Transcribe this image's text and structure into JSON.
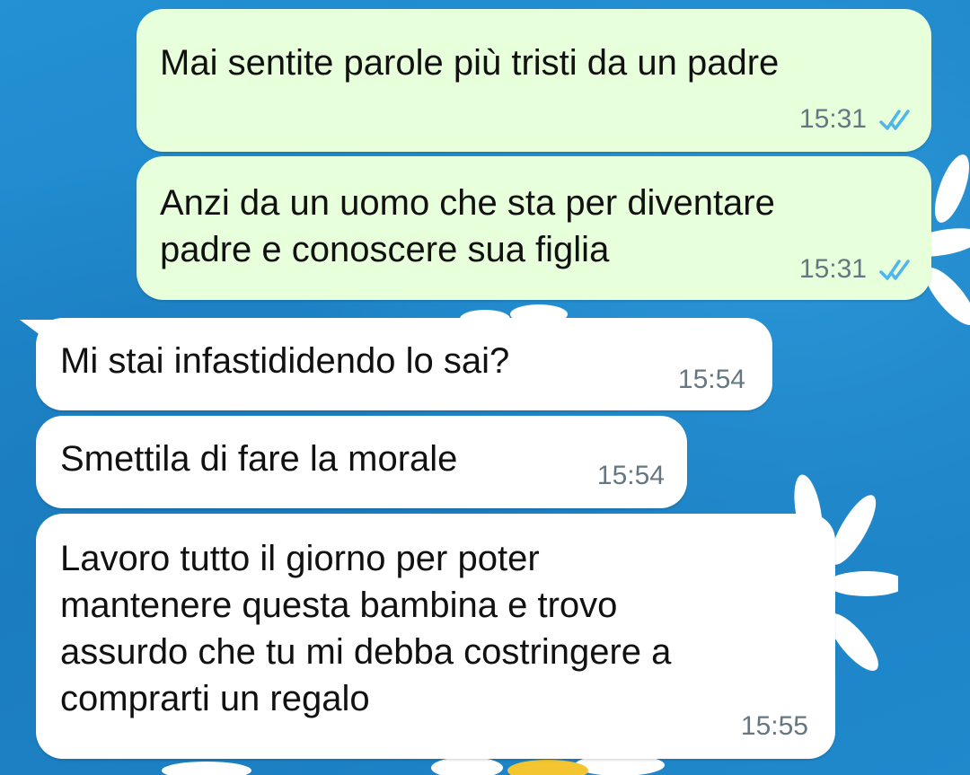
{
  "chat": {
    "messages": [
      {
        "direction": "outgoing",
        "text": "Mai sentite parole più tristi da un padre",
        "time": "15:31",
        "status": "read",
        "status_icon": "double-check-icon"
      },
      {
        "direction": "outgoing",
        "text": "Anzi da un uomo che sta per diventare\npadre e conoscere sua figlia",
        "time": "15:31",
        "status": "read",
        "status_icon": "double-check-icon"
      },
      {
        "direction": "incoming",
        "text": "Mi stai infastididendo lo sai?",
        "time": "15:54"
      },
      {
        "direction": "incoming",
        "text": "Smettila di fare la morale",
        "time": "15:54"
      },
      {
        "direction": "incoming",
        "text": "Lavoro tutto il giorno per poter\nmantenere questa bambina e trovo\nassurdo che tu mi debba costringere a\ncomprarti un regalo",
        "time": "15:55"
      }
    ]
  },
  "theme": {
    "outgoing_bubble": "#e7ffdb",
    "incoming_bubble": "#ffffff",
    "read_tick_color": "#4fb6ec",
    "timestamp_color": "#667781",
    "wallpaper_color": "#1f86c9",
    "wallpaper_motif": "white daisies on blue"
  }
}
